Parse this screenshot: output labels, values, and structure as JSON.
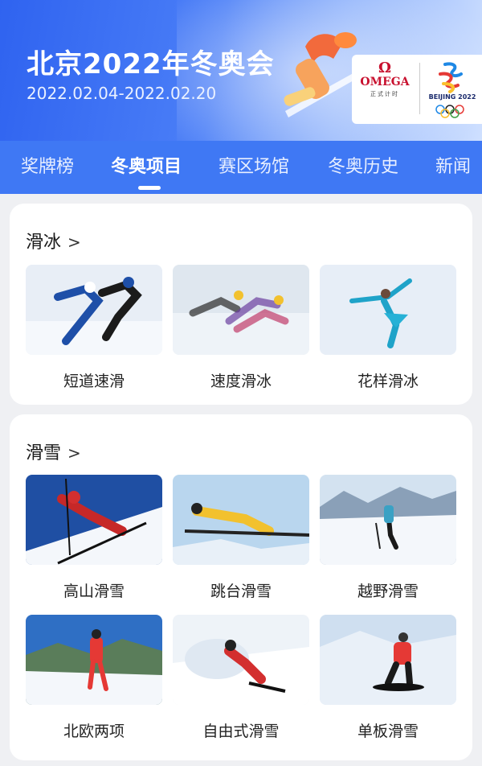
{
  "header": {
    "title": "北京2022年冬奥会",
    "dates": "2022.02.04-2022.02.20",
    "sponsor_logo": "OMEGA",
    "sponsor_sub": "正式计时",
    "games_logo": "BEIJING 2022"
  },
  "tabs": [
    {
      "label": "奖牌榜",
      "active": false
    },
    {
      "label": "冬奥项目",
      "active": true
    },
    {
      "label": "赛区场馆",
      "active": false
    },
    {
      "label": "冬奥历史",
      "active": false
    },
    {
      "label": "新闻",
      "active": false
    }
  ],
  "sections": [
    {
      "title": "滑冰",
      "items": [
        {
          "label": "短道速滑",
          "image": "short-track-image"
        },
        {
          "label": "速度滑冰",
          "image": "speed-skating-image"
        },
        {
          "label": "花样滑冰",
          "image": "figure-skating-image"
        }
      ]
    },
    {
      "title": "滑雪",
      "items": [
        {
          "label": "高山滑雪",
          "image": "alpine-skiing-image"
        },
        {
          "label": "跳台滑雪",
          "image": "ski-jumping-image"
        },
        {
          "label": "越野滑雪",
          "image": "cross-country-image"
        },
        {
          "label": "北欧两项",
          "image": "nordic-combined-image"
        },
        {
          "label": "自由式滑雪",
          "image": "freestyle-image"
        },
        {
          "label": "单板滑雪",
          "image": "snowboard-image"
        }
      ]
    }
  ],
  "colors": {
    "brand_blue": "#3f78f4",
    "page_bg": "#eff0f3"
  }
}
